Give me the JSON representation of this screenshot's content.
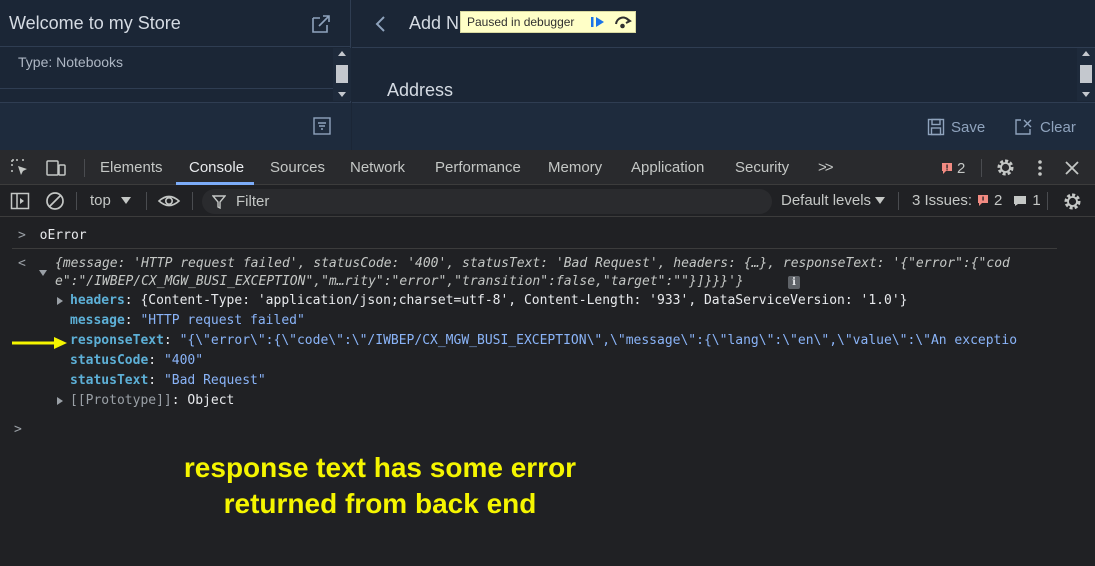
{
  "app": {
    "left": {
      "title": "Welcome to my Store",
      "list_item": "Type: Notebooks"
    },
    "right": {
      "title": "Add N",
      "section_heading": "Address",
      "save_label": "Save",
      "clear_label": "Clear"
    },
    "debugger_banner": "Paused in debugger"
  },
  "devtools": {
    "tabs": [
      "Elements",
      "Console",
      "Sources",
      "Network",
      "Performance",
      "Memory",
      "Application",
      "Security"
    ],
    "active_tab": "Console",
    "more_tabs": ">>",
    "issue_badge_count": "2",
    "toolbar": {
      "context": "top",
      "filter_placeholder": "Filter",
      "levels": "Default levels",
      "issues_label": "3 Issues:",
      "issues_errors": "2",
      "issues_info": "1"
    }
  },
  "console": {
    "input_expression": "oError",
    "preview": {
      "line1": "{message: 'HTTP request failed', statusCode: '400', statusText: 'Bad Request', headers: {…}, responseText: '{\"error\":{\"cod",
      "line2": "e\":\"/IWBEP/CX_MGW_BUSI_EXCEPTION\",\"m…rity\":\"error\",\"transition\":false,\"target\":\"\"}]}}}'}"
    },
    "props": [
      {
        "key": "headers",
        "value": "{Content-Type: 'application/json;charset=utf-8', Content-Length: '933', DataServiceVersion: '1.0'}"
      },
      {
        "key": "message",
        "value": "\"HTTP request failed\""
      },
      {
        "key": "responseText",
        "value": "\"{\\\"error\\\":{\\\"code\\\":\\\"/IWBEP/CX_MGW_BUSI_EXCEPTION\\\",\\\"message\\\":{\\\"lang\\\":\\\"en\\\",\\\"value\\\":\\\"An exceptio"
      },
      {
        "key": "statusCode",
        "value": "\"400\""
      },
      {
        "key": "statusText",
        "value": "\"Bad Request\""
      },
      {
        "key": "[[Prototype]]",
        "value": "Object"
      }
    ]
  },
  "annotation": {
    "line1": "response text has some error",
    "line2": "returned from back end"
  },
  "colors": {
    "app_bg": "#1b2636",
    "devtools_bg": "#202124",
    "key_color": "#5db0d7",
    "string_color": "#8ab4f8",
    "annotation_color": "#f5f500",
    "arrow_color": "#f5f500"
  }
}
